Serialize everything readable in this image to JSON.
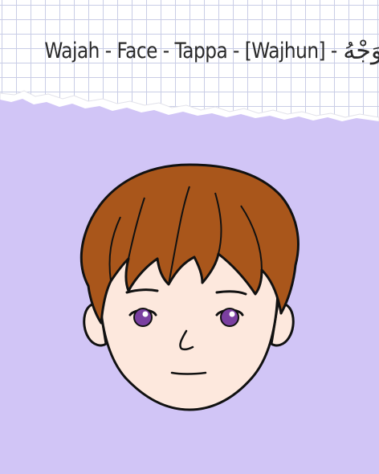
{
  "title": {
    "latin": "Wajah - Face - Tappa - [Wajhun] -",
    "arabic": "وَجْهُ"
  },
  "colors": {
    "paper": "#ffffff",
    "grid_line": "#c9cde6",
    "lavender": "#d1c5f6",
    "hair": "#a9561b",
    "hair_highlight": "#c26a26",
    "skin": "#fde8dd",
    "eye": "#7a3fa0",
    "outline": "#111111"
  }
}
